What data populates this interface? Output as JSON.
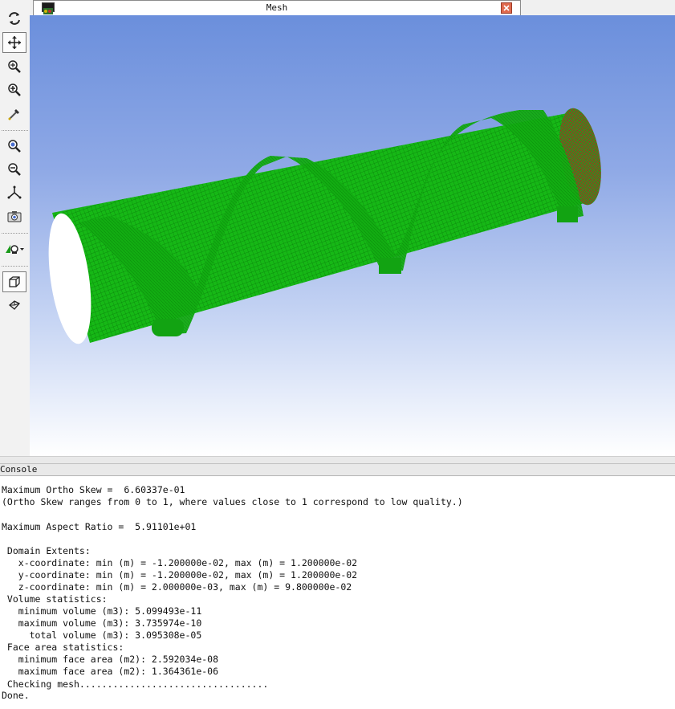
{
  "window": {
    "title": "Mesh"
  },
  "toolbar": {
    "buttons": [
      {
        "name": "rotate-icon"
      },
      {
        "name": "pan-icon"
      },
      {
        "name": "zoom-in-out-icon"
      },
      {
        "name": "zoom-to-area-icon"
      },
      {
        "name": "select-probe-icon"
      },
      {
        "name": "zoom-fit-icon"
      },
      {
        "name": "zoom-out-icon"
      },
      {
        "name": "axes-icon"
      },
      {
        "name": "camera-icon"
      },
      {
        "name": "view-lights-icon"
      },
      {
        "name": "box-select-icon"
      },
      {
        "name": "box-shape-icon"
      }
    ]
  },
  "colors": {
    "mesh_green": "#11a811",
    "mesh_red_edge": "#b22222",
    "viewport_top": "#6b8fdc",
    "viewport_bottom": "#ffffff"
  },
  "console": {
    "title": "Console",
    "lines": [
      "Maximum Ortho Skew =  6.60337e-01",
      "(Ortho Skew ranges from 0 to 1, where values close to 1 correspond to low quality.)",
      "",
      "Maximum Aspect Ratio =  5.91101e+01",
      "",
      " Domain Extents:",
      "   x-coordinate: min (m) = -1.200000e-02, max (m) = 1.200000e-02",
      "   y-coordinate: min (m) = -1.200000e-02, max (m) = 1.200000e-02",
      "   z-coordinate: min (m) = 2.000000e-03, max (m) = 9.800000e-02",
      " Volume statistics:",
      "   minimum volume (m3): 5.099493e-11",
      "   maximum volume (m3): 3.735974e-10",
      "     total volume (m3): 3.095308e-05",
      " Face area statistics:",
      "   minimum face area (m2): 2.592034e-08",
      "   maximum face area (m2): 1.364361e-06",
      " Checking mesh..................................",
      "Done."
    ]
  }
}
